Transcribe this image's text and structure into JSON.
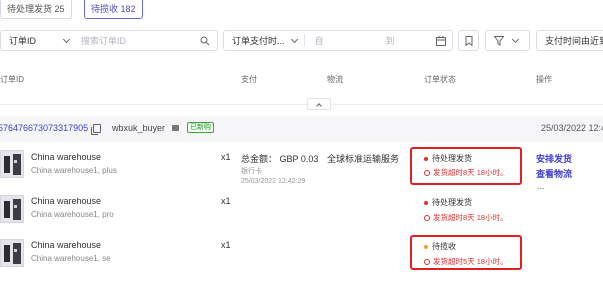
{
  "tabs": [
    {
      "label": "待处理发货 25"
    },
    {
      "label": "待揽收 182"
    }
  ],
  "filters": {
    "order_id_select": "订单ID",
    "order_id_placeholder": "搜索订单ID",
    "pay_time_select": "订单支付时...",
    "date_start_placeholder": "自",
    "date_end_placeholder": "到",
    "sort_label": "支付时间由近到"
  },
  "columns": {
    "order_id": "订单ID",
    "payment": "支付",
    "logistics": "物流",
    "status": "订单状态",
    "actions": "操作"
  },
  "order": {
    "id": "576476673073317905",
    "buyer": "wbxuk_buyer",
    "badge": "已新购",
    "date": "25/03/2022 12:4",
    "payment_total": "总金额： GBP 0.03",
    "payment_method": "银行卡",
    "payment_time": "25/03/2022 12:42:29",
    "logistics": "全球标准运输服务",
    "actions": {
      "arrange": "安排发货",
      "track": "查看物流",
      "more": "..."
    }
  },
  "items": [
    {
      "name": "China warehouse",
      "sku": "China warehouse1, plus",
      "qty": "x1",
      "status": "待处理发货",
      "status_color": "#e03030",
      "warning": "发货超时8天 18小时。"
    },
    {
      "name": "China warehouse",
      "sku": "China warehouse1, pro",
      "qty": "x1",
      "status": "待处理发货",
      "status_color": "#e03030",
      "warning": "发货超时8天 18小时。"
    },
    {
      "name": "China warehouse",
      "sku": "China warehouse1, se",
      "qty": "x1",
      "status": "待揽收",
      "status_color": "#f5a020",
      "warning": "发货超时5天 18小时。"
    }
  ]
}
